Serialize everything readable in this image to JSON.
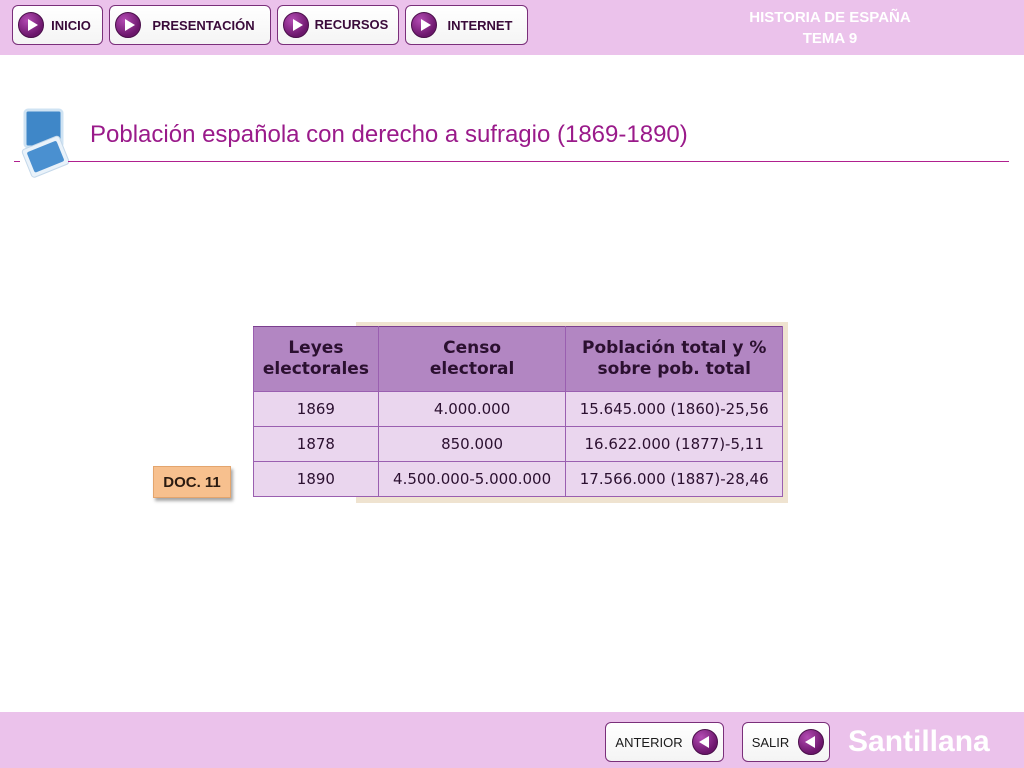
{
  "nav": {
    "inicio": "INICIO",
    "presentacion": "PRESENTACIÓN",
    "recursos": "RECURSOS",
    "internet": "INTERNET"
  },
  "header": {
    "course_line1": "HISTORIA DE ESPAÑA",
    "course_line2": "TEMA 9"
  },
  "page": {
    "title": "Población española con derecho a sufragio (1869-1890)"
  },
  "table": {
    "headers": [
      "Leyes\nelectorales",
      "Censo\nelectoral",
      "Población total y %\nsobre pob. total"
    ],
    "rows": [
      [
        "1869",
        "4.000.000",
        "15.645.000 (1860)-25,56"
      ],
      [
        "1878",
        "850.000",
        "16.622.000 (1877)-5,11"
      ],
      [
        "1890",
        "4.500.000-5.000.000",
        "17.566.000 (1887)-28,46"
      ]
    ]
  },
  "doc_label": "DOC. 11",
  "footer": {
    "anterior": "ANTERIOR",
    "salir": "SALIR",
    "brand": "Santillana"
  },
  "colors": {
    "bar_background": "#ebc2eb",
    "title": "#9a1a8a",
    "table_header": "#b286c2",
    "table_cell": "#ead6ee",
    "doc_label": "#f7c08e"
  },
  "icons": {
    "nav_button": "play-icon",
    "footer_button": "back-arrow-icon",
    "heading": "document-stack-icon"
  }
}
